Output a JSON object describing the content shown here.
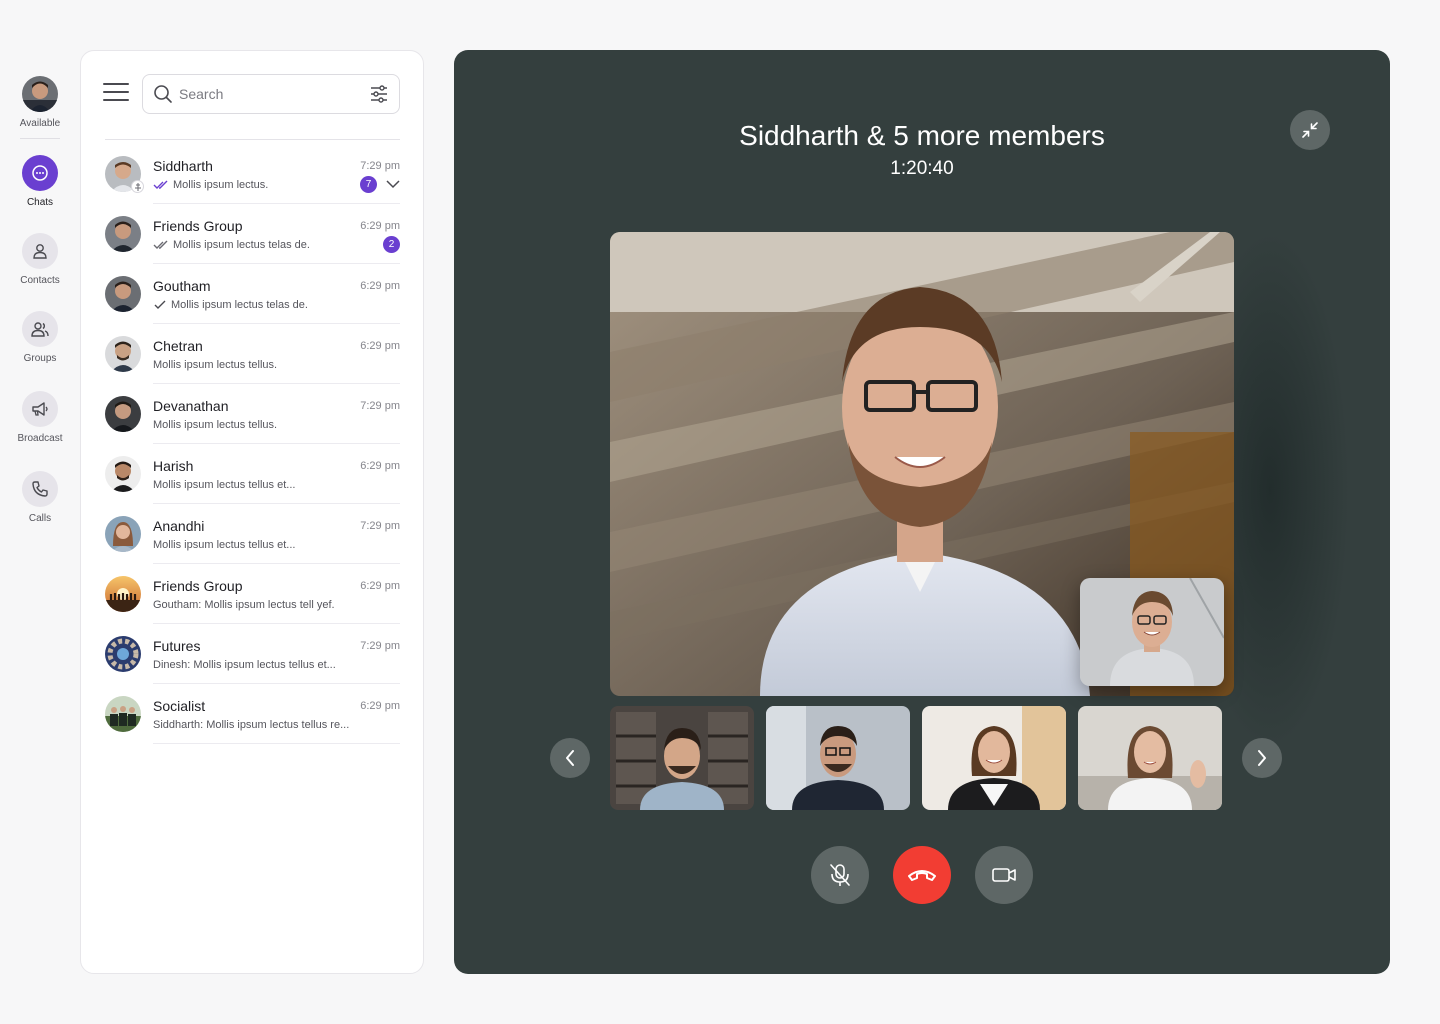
{
  "rail": {
    "status_label": "Available",
    "items": [
      {
        "label": "Chats",
        "icon": "chat-bubble-icon",
        "active": true
      },
      {
        "label": "Contacts",
        "icon": "contact-icon",
        "active": false
      },
      {
        "label": "Groups",
        "icon": "groups-icon",
        "active": false
      },
      {
        "label": "Broadcast",
        "icon": "megaphone-icon",
        "active": false
      },
      {
        "label": "Calls",
        "icon": "phone-icon",
        "active": false
      }
    ]
  },
  "search": {
    "placeholder": "Search"
  },
  "chats": [
    {
      "name": "Siddharth",
      "time": "7:29 pm",
      "message": "Mollis ipsum lectus.",
      "tick": "double",
      "badge": "7",
      "pinned": true,
      "expand": true
    },
    {
      "name": "Friends Group",
      "time": "6:29 pm",
      "message": "Mollis ipsum lectus telas de.",
      "tick": "double",
      "badge": "2"
    },
    {
      "name": "Goutham",
      "time": "6:29 pm",
      "message": "Mollis ipsum lectus telas de.",
      "tick": "single"
    },
    {
      "name": "Chetran",
      "time": "6:29 pm",
      "message": "Mollis ipsum lectus tellus."
    },
    {
      "name": "Devanathan",
      "time": "7:29 pm",
      "message": "Mollis ipsum lectus tellus."
    },
    {
      "name": "Harish",
      "time": "6:29 pm",
      "message": "Mollis ipsum lectus tellus et..."
    },
    {
      "name": "Anandhi",
      "time": "7:29 pm",
      "message": "Mollis ipsum lectus tellus et..."
    },
    {
      "name": "Friends Group",
      "time": "6:29 pm",
      "message": "Goutham: Mollis ipsum lectus tell yef."
    },
    {
      "name": "Futures",
      "time": "7:29 pm",
      "message": "Dinesh: Mollis ipsum lectus tellus et..."
    },
    {
      "name": "Socialist",
      "time": "6:29 pm",
      "message": "Siddharth: Mollis ipsum lectus tellus re..."
    }
  ],
  "call": {
    "title": "Siddharth & 5 more members",
    "duration": "1:20:40"
  },
  "colors": {
    "accent": "#6a3fd0",
    "call_background": "#343f3e",
    "end_call": "#f23d33",
    "control_button": "#5e6766"
  }
}
